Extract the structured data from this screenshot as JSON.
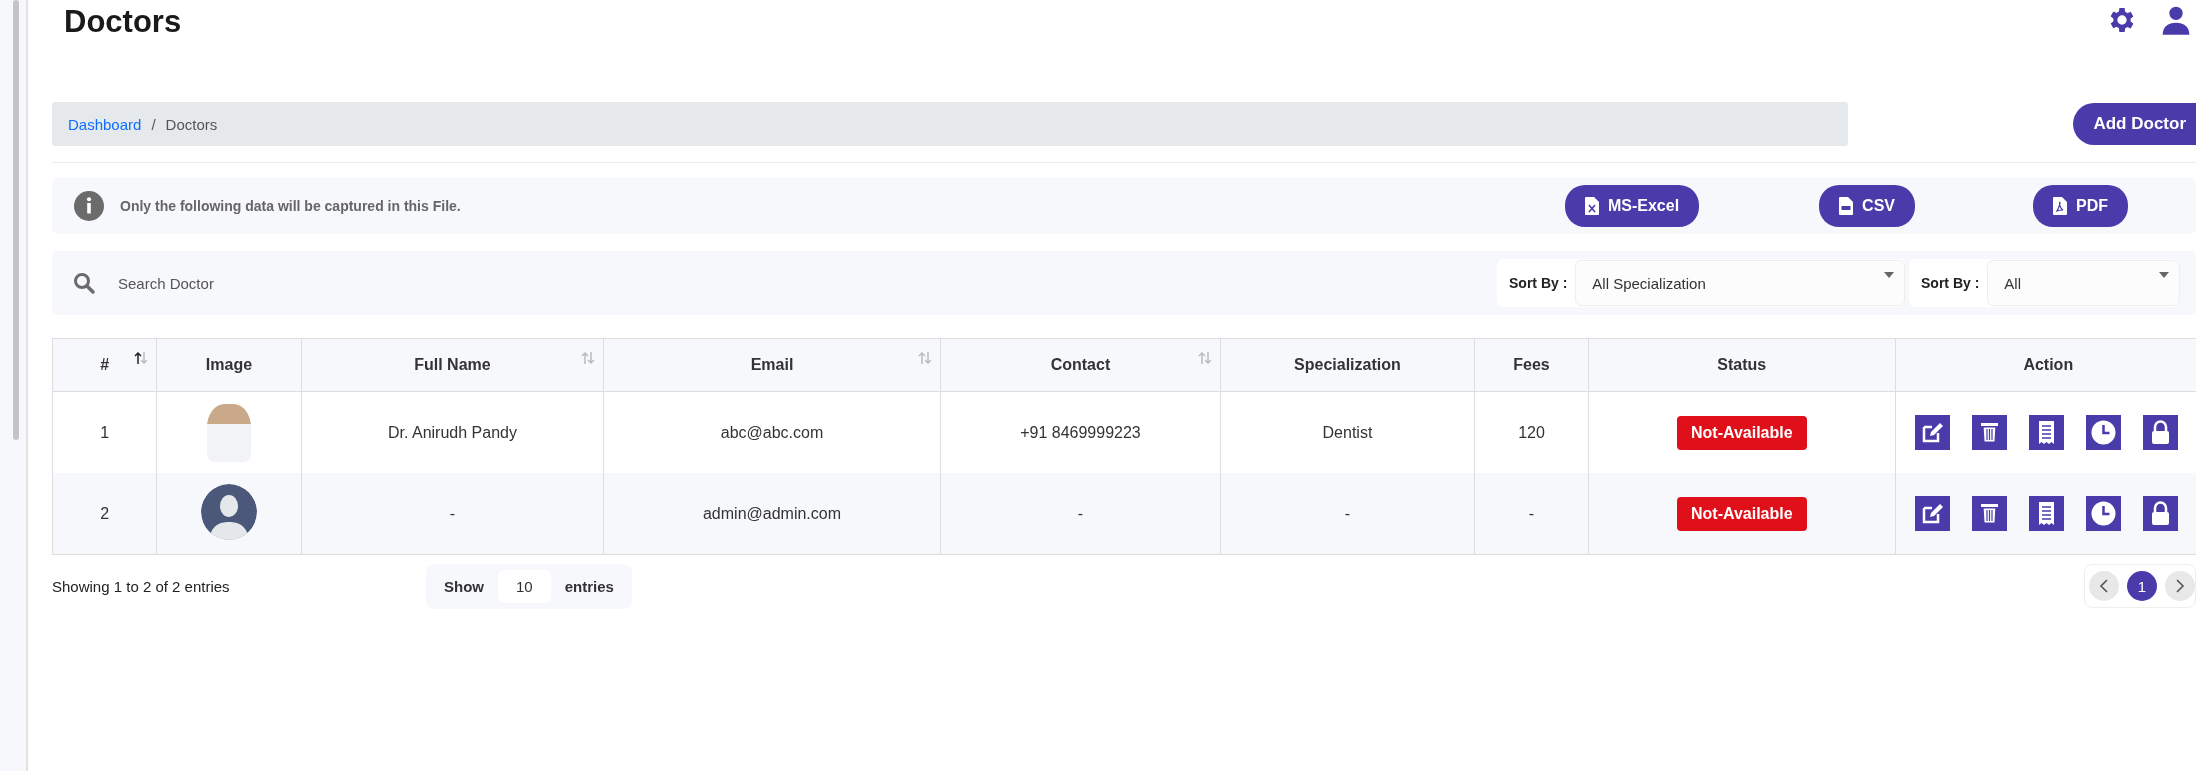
{
  "page_title": "Doctors",
  "breadcrumb": [
    {
      "label": "Dashboard",
      "kind": "link"
    },
    {
      "label": "Doctors",
      "kind": "current"
    }
  ],
  "breadcrumb_separator": "/",
  "add_button": "Add Doctor",
  "export": {
    "note": "Only the following data will be captured in this File.",
    "buttons": [
      {
        "label": "MS-Excel",
        "kind": "excel"
      },
      {
        "label": "CSV",
        "kind": "csv"
      },
      {
        "label": "PDF",
        "kind": "pdf"
      }
    ]
  },
  "search": {
    "placeholder": "Search Doctor"
  },
  "filters": [
    {
      "label": "Sort By :",
      "value": "All Specialization"
    },
    {
      "label": "Sort By :",
      "value": "All"
    }
  ],
  "table": {
    "columns": [
      {
        "label": "#",
        "kind": "sorted"
      },
      {
        "label": "Image",
        "kind": "plain"
      },
      {
        "label": "Full Name",
        "kind": "sortable"
      },
      {
        "label": "Email",
        "kind": "sortable"
      },
      {
        "label": "Contact",
        "kind": "sortable"
      },
      {
        "label": "Specialization",
        "kind": "plain"
      },
      {
        "label": "Fees",
        "kind": "plain"
      },
      {
        "label": "Status",
        "kind": "plain"
      },
      {
        "label": "Action",
        "kind": "plain"
      }
    ],
    "rows": [
      {
        "index": "1",
        "kind": "photo",
        "name": "Dr. Anirudh Pandy",
        "email": "abc@abc.com",
        "contact": "+91 8469999223",
        "specialization": "Dentist",
        "fees": "120",
        "status": "Not-Available"
      },
      {
        "index": "2",
        "kind": "avatar",
        "name": "-",
        "email": "admin@admin.com",
        "contact": "-",
        "specialization": "-",
        "fees": "-",
        "status": "Not-Available"
      }
    ]
  },
  "summary": "Showing 1 to 2 of 2 entries",
  "page_size": {
    "before": "Show",
    "value": "10",
    "after": "entries"
  },
  "pagination": [
    {
      "label": "1",
      "selected": true
    }
  ]
}
